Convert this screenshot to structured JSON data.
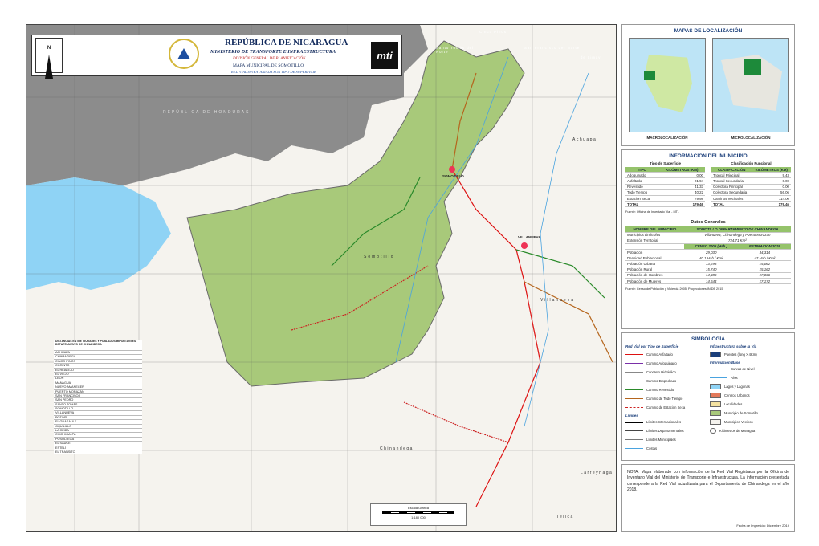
{
  "header": {
    "country": "REPÚBLICA DE NICARAGUA",
    "ministry": "MINISTERIO DE TRANSPORTE E INFRAESTRUCTURA",
    "division": "DIVISIÓN GENERAL DE PLANIFICACIÓN",
    "map_name": "MAPA MUNICIPAL DE SOMOTILLO",
    "subtitle": "RED VIAL INVENTARIADA POR TIPO DE SUPERFICIE",
    "logo_text": "mti",
    "north": "N"
  },
  "map_labels": {
    "honduras": "REPÚBLICA DE HONDURAS",
    "somotillo_town": "SOMOTILLO",
    "villanueva_town": "VILLANUEVA",
    "somotillo_muni": "Somotillo",
    "villanueva_muni": "Villanueva",
    "chinandega": "Chinandega",
    "achuapa": "Achuapa",
    "santo_tomas": "Santo Tomás del Norte",
    "san_francisco": "San Francisco del Norte",
    "cinco_pinos": "Cinco Pinos",
    "san_pedro": "San Pedro del Norte",
    "limay": "de Limay",
    "larreynaga": "Larreynaga",
    "telica": "Telica",
    "leon": "León",
    "scale_title": "Escala Gráfica",
    "scale_ratio": "1:180 000"
  },
  "localizacion": {
    "title": "MAPAS DE LOCALIZACIÓN",
    "macro": "MACROLOCALIZACIÓN",
    "micro": "MICROLOCALIZACIÓN",
    "macro_label": "REPÚBLICA DE NICARAGUA",
    "micro_label": "CHINANDEGA"
  },
  "info": {
    "title": "INFORMACIÓN DEL MUNICIPIO",
    "tipo_title": "Tipo de Superficie",
    "clas_title": "Clasificación Funcional",
    "tipo_header": [
      "TIPO",
      "KILÓMETROS (KM)"
    ],
    "clas_header": [
      "CLASIFICACIÓN",
      "KILÓMETROS (KM)"
    ],
    "tipo_rows": [
      [
        "Adoquinado",
        "0.00"
      ],
      [
        "Asfaltado",
        "21.94"
      ],
      [
        "Revestido",
        "41.33"
      ],
      [
        "Todo Tiempo",
        "40.22"
      ],
      [
        "Estación Seca",
        "79.98"
      ]
    ],
    "clas_rows": [
      [
        "Troncal Principal",
        "9.43"
      ],
      [
        "Troncal Secundaria",
        "0.00"
      ],
      [
        "Colectora Principal",
        "0.00"
      ],
      [
        "Colectora Secundaria",
        "56.06"
      ],
      [
        "Caminos Vecinales",
        "114.00"
      ]
    ],
    "tipo_total": [
      "TOTAL",
      "179.46"
    ],
    "clas_total": [
      "TOTAL",
      "179.46"
    ],
    "fuente1": "Fuente: Oficina de Inventario Vial - MTI."
  },
  "datos": {
    "title": "Datos Generales",
    "col_name": "NOMBRE DEL MUNICIPIO",
    "col_value": "SOMOTILLO DEPARTAMENTO DE CHINANDEGA",
    "limitrofes_label": "Municipios Limítrofes",
    "limitrofes_value": "Villanueva, Chinandega y Puerto Morazán",
    "extension_label": "Extensión Territorial",
    "extension_value": "724.71 Km²",
    "censo": "CENSO 2005 (Hab.)",
    "estimacion": "ESTIMACIÓN 2015",
    "rows": [
      [
        "Población",
        "29,030",
        "34,314"
      ],
      [
        "Densidad Poblacional",
        "40.1 Hab / Km²",
        "47 Hab / Km²"
      ],
      [
        "Población Urbana",
        "13,298",
        "15,062"
      ],
      [
        "Población Rural",
        "15,740",
        "15,162"
      ],
      [
        "Población de Hombres",
        "14,486",
        "17,066"
      ],
      [
        "Población de Mujeres",
        "14,544",
        "17,172"
      ]
    ],
    "fuente2": "Fuente: Censo de Población y Vivienda 2005, Proyecciones INIDE 2015"
  },
  "simbologia": {
    "title": "SIMBOLOGÍA",
    "red_vial_title": "Red Vial por Tipo de Superficie",
    "red_vial": [
      {
        "label": "Camino Asfaltado",
        "color": "#d11"
      },
      {
        "label": "Camino Adoquinado",
        "color": "#7a2fa8"
      },
      {
        "label": "Concreto Hidráulico",
        "color": "#888"
      },
      {
        "label": "Camino Empedrado",
        "color": "#d66"
      },
      {
        "label": "Camino Revestido",
        "color": "#2a8a2a"
      },
      {
        "label": "Camino de Todo Tiempo",
        "color": "#b5651d"
      },
      {
        "label": "Camino de Estación Seca",
        "color": "#c22"
      }
    ],
    "limites_title": "Límites",
    "limites": [
      "Límites Internacionales",
      "Límites Departamentales",
      "Límites Municipales",
      "Costas"
    ],
    "infra_title": "Infraestructura sobre la Vía",
    "infra": [
      "Puentes (long > 4Km)"
    ],
    "base_title": "Información Base",
    "base": [
      "Curvas de Nivel",
      "Ríos",
      "Lagos y Lagunas",
      "Centros Urbanos",
      "Localidades",
      "Municipio de Somotillo",
      "Municipios Vecinos",
      "Kilómetros de Managua"
    ]
  },
  "nota": "NOTA: Mapa elaborado con información de la Red Vial Registrada por la Oficina de Inventario Vial del Ministerio de Transporte e Infraestructura. La información presentada corresponde a la Red Vial actualizada para el Departamento de Chinandega en el año 2018.",
  "fecha": "Fecha de Impresión: Diciembre 2019",
  "distancias": {
    "title": "DISTANCIAS ENTRE CIUDADES Y POBLADOS IMPORTANTES DEPARTAMENTO DE CHINANDEGA",
    "places": [
      "ACHUAPA",
      "CHINANDEGA",
      "CINCO PINOS",
      "CORINTO",
      "EL REALEJO",
      "EL VIEJO",
      "LEÓN",
      "MANAGUA",
      "NUEVO AMANECER",
      "PUERTO MORAZÁN",
      "SAN FRANCISCO",
      "SAN PEDRO",
      "SANTO TOMÁS",
      "SOMOTILLO",
      "VILLANUEVA",
      "POTOSÍ",
      "EL GUASAULE",
      "JIQUILILLO",
      "LA CEIBA",
      "CHICHIGALPA",
      "POSOLTEGA",
      "EL SAUCE",
      "ESTELÍ",
      "EL TRANSITO"
    ]
  }
}
